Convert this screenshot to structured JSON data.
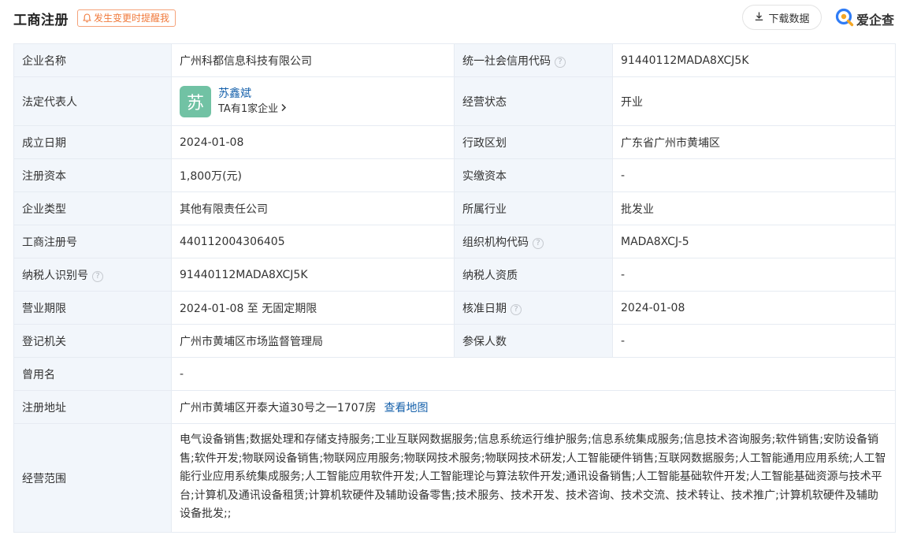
{
  "header": {
    "title": "工商注册",
    "remind_label": "发生变更时提醒我",
    "download_label": "下载数据",
    "brand_name": "爱企查"
  },
  "rows": {
    "company_name": {
      "label": "企业名称",
      "value": "广州科都信息科技有限公司"
    },
    "credit_code": {
      "label": "统一社会信用代码",
      "value": "91440112MADA8XCJ5K"
    },
    "legal_rep": {
      "label": "法定代表人",
      "avatar_char": "苏",
      "name": "苏鑫斌",
      "related": "TA有1家企业"
    },
    "status": {
      "label": "经营状态",
      "value": "开业"
    },
    "founded": {
      "label": "成立日期",
      "value": "2024-01-08"
    },
    "region": {
      "label": "行政区划",
      "value": "广东省广州市黄埔区"
    },
    "reg_capital": {
      "label": "注册资本",
      "value": "1,800万(元)"
    },
    "paid_capital": {
      "label": "实缴资本",
      "value": "-"
    },
    "company_type": {
      "label": "企业类型",
      "value": "其他有限责任公司"
    },
    "industry": {
      "label": "所属行业",
      "value": "批发业"
    },
    "reg_number": {
      "label": "工商注册号",
      "value": "440112004306405"
    },
    "org_code": {
      "label": "组织机构代码",
      "value": "MADA8XCJ-5"
    },
    "taxpayer_id": {
      "label": "纳税人识别号",
      "value": "91440112MADA8XCJ5K"
    },
    "taxpayer_qual": {
      "label": "纳税人资质",
      "value": "-"
    },
    "term": {
      "label": "营业期限",
      "value": "2024-01-08 至 无固定期限"
    },
    "approval_date": {
      "label": "核准日期",
      "value": "2024-01-08"
    },
    "authority": {
      "label": "登记机关",
      "value": "广州市黄埔区市场监督管理局"
    },
    "insured": {
      "label": "参保人数",
      "value": "-"
    },
    "former_name": {
      "label": "曾用名",
      "value": "-"
    },
    "address": {
      "label": "注册地址",
      "value": "广州市黄埔区开泰大道30号之一1707房",
      "map_link": "查看地图"
    },
    "scope": {
      "label": "经营范围",
      "value": "电气设备销售;数据处理和存储支持服务;工业互联网数据服务;信息系统运行维护服务;信息系统集成服务;信息技术咨询服务;软件销售;安防设备销售;软件开发;物联网设备销售;物联网应用服务;物联网技术服务;物联网技术研发;人工智能硬件销售;互联网数据服务;人工智能通用应用系统;人工智能行业应用系统集成服务;人工智能应用软件开发;人工智能理论与算法软件开发;通讯设备销售;人工智能基础软件开发;人工智能基础资源与技术平台;计算机及通讯设备租赁;计算机软硬件及辅助设备零售;技术服务、技术开发、技术咨询、技术交流、技术转让、技术推广;计算机软硬件及辅助设备批发;;"
    }
  },
  "colors": {
    "label_bg": "#f2f6fb",
    "border": "#e6ebf2",
    "link": "#1661ab",
    "remind": "#f07a3c",
    "avatar_bg": "#71c2a4"
  },
  "icons": [
    "bell-icon",
    "download-icon",
    "brand-logo-icon",
    "help-icon",
    "chevron-right-icon"
  ]
}
